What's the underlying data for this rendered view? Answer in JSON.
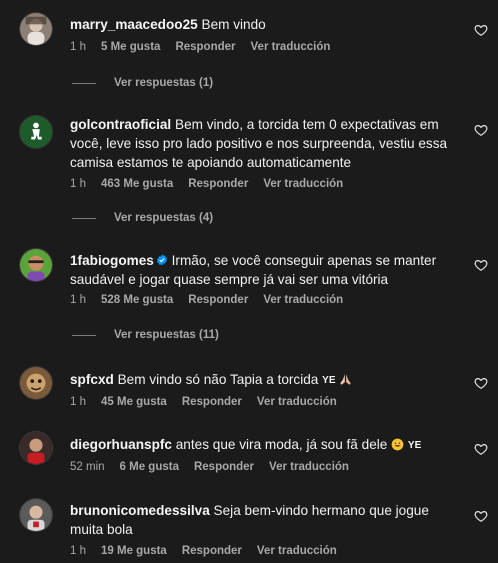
{
  "comments": [
    {
      "username": "marry_maacedoo25",
      "text": "Bem vindo",
      "time": "1 h",
      "likes": "5 Me gusta",
      "reply": "Responder",
      "translate": "Ver traducción",
      "replies": "Ver respuestas (1)"
    },
    {
      "username": "golcontraoficial",
      "text": "Bem vindo, a torcida tem 0 expectativas em você, leve isso pro lado positivo e nos surpreenda, vestiu essa camisa estamos te apoiando automaticamente",
      "time": "1 h",
      "likes": "463 Me gusta",
      "reply": "Responder",
      "translate": "Ver traducción",
      "replies": "Ver respuestas (4)"
    },
    {
      "username": "1fabiogomes",
      "text": "Irmão, se você conseguir apenas se manter saudável e jogar quase sempre já vai ser uma vitória",
      "time": "1 h",
      "likes": "528 Me gusta",
      "reply": "Responder",
      "translate": "Ver traducción",
      "replies": "Ver respuestas (11)"
    },
    {
      "username": "spfcxd",
      "text": "Bem vindo só não Tapia a torcida",
      "suffix": "YE",
      "time": "1 h",
      "likes": "45 Me gusta",
      "reply": "Responder",
      "translate": "Ver traducción"
    },
    {
      "username": "diegorhuanspfc",
      "text": "antes que vira moda, já sou fã dele",
      "suffix": "YE",
      "time": "52 min",
      "likes": "6 Me gusta",
      "reply": "Responder",
      "translate": "Ver traducción"
    },
    {
      "username": "brunonicomedessilva",
      "text": "Seja bem-vindo hermano que jogue muita bola",
      "time": "1 h",
      "likes": "19 Me gusta",
      "reply": "Responder",
      "translate": "Ver traducción"
    }
  ],
  "colors": {
    "background": "#1b1b1b",
    "text": "#f5f5f5",
    "meta": "#a8a8a8",
    "verified": "#0095f6"
  },
  "icons": {
    "like": "heart-outline-icon",
    "verified": "verified-badge-icon"
  }
}
